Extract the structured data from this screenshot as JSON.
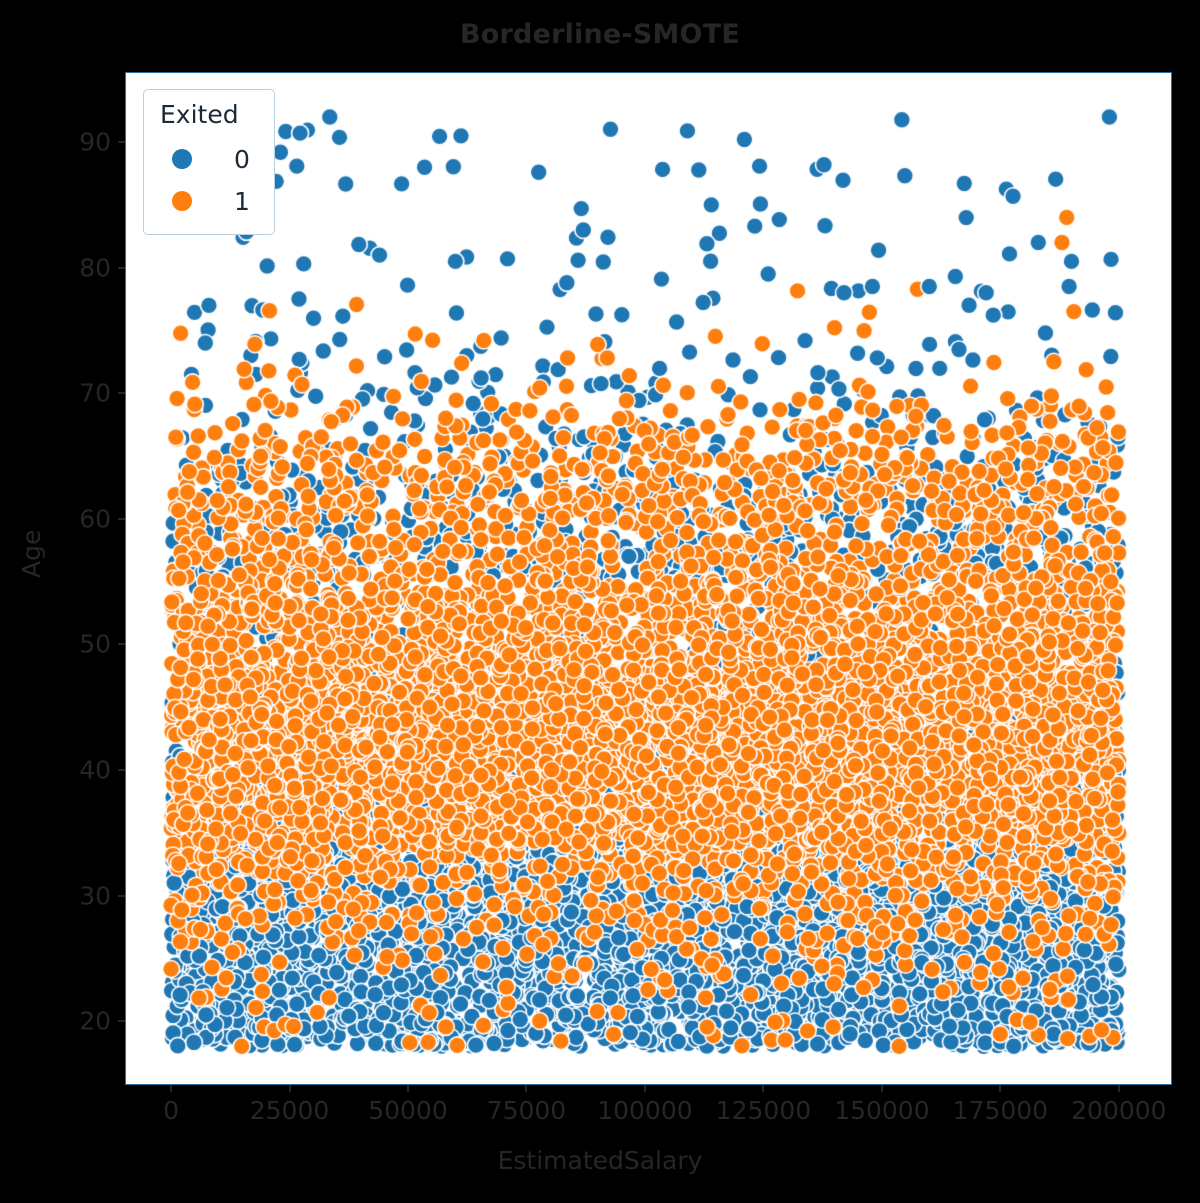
{
  "chart_data": {
    "type": "scatter",
    "title": "Borderline-SMOTE",
    "xlabel": "EstimatedSalary",
    "ylabel": "Age",
    "xlim": [
      -9500,
      211000
    ],
    "ylim": [
      15.0,
      95.5
    ],
    "xticks": [
      0,
      25000,
      50000,
      75000,
      100000,
      125000,
      150000,
      175000,
      200000
    ],
    "xtick_labels": [
      "0",
      "25000",
      "50000",
      "75000",
      "100000",
      "125000",
      "150000",
      "175000",
      "200000"
    ],
    "yticks": [
      20,
      30,
      40,
      50,
      60,
      70,
      80,
      90
    ],
    "ytick_labels": [
      "20",
      "30",
      "40",
      "50",
      "60",
      "70",
      "80",
      "90"
    ],
    "grid": false,
    "legend": {
      "title": "Exited",
      "position": "upper-left",
      "entries": [
        {
          "label": "0",
          "color": "#1f77b4"
        },
        {
          "label": "1",
          "color": "#ff7f0e"
        }
      ]
    },
    "marker": {
      "shape": "circle",
      "size": 17,
      "edge_color": "#ffffff",
      "edge_width": 1.5,
      "alpha": 1.0
    },
    "series": [
      {
        "name": "0",
        "color": "#1f77b4",
        "n_points": 6400,
        "x_range": [
          0,
          200000
        ],
        "age_distribution": "right-skewed, concentrated 18-45, tail to 92",
        "age_median": 34,
        "age_min": 18,
        "age_max": 92
      },
      {
        "name": "1",
        "color": "#ff7f0e",
        "n_points": 6400,
        "x_range": [
          0,
          200000
        ],
        "age_distribution": "centered 38-55 dense band, tail to 84",
        "age_median": 45,
        "age_min": 18,
        "age_max": 84
      }
    ],
    "notes": "Borderline-SMOTE oversampled churn dataset: class 1 (orange) synthetically balanced to class 0 (blue) count; orange saturates the 33-62 age band across all salaries, blue dominates 18-30 and the sparse 63-92 tail."
  },
  "figure": {
    "background_color": "#000000",
    "axes_background_color": "#ffffff",
    "text_color": "#262626",
    "spine_color": "#2c6f9e"
  }
}
